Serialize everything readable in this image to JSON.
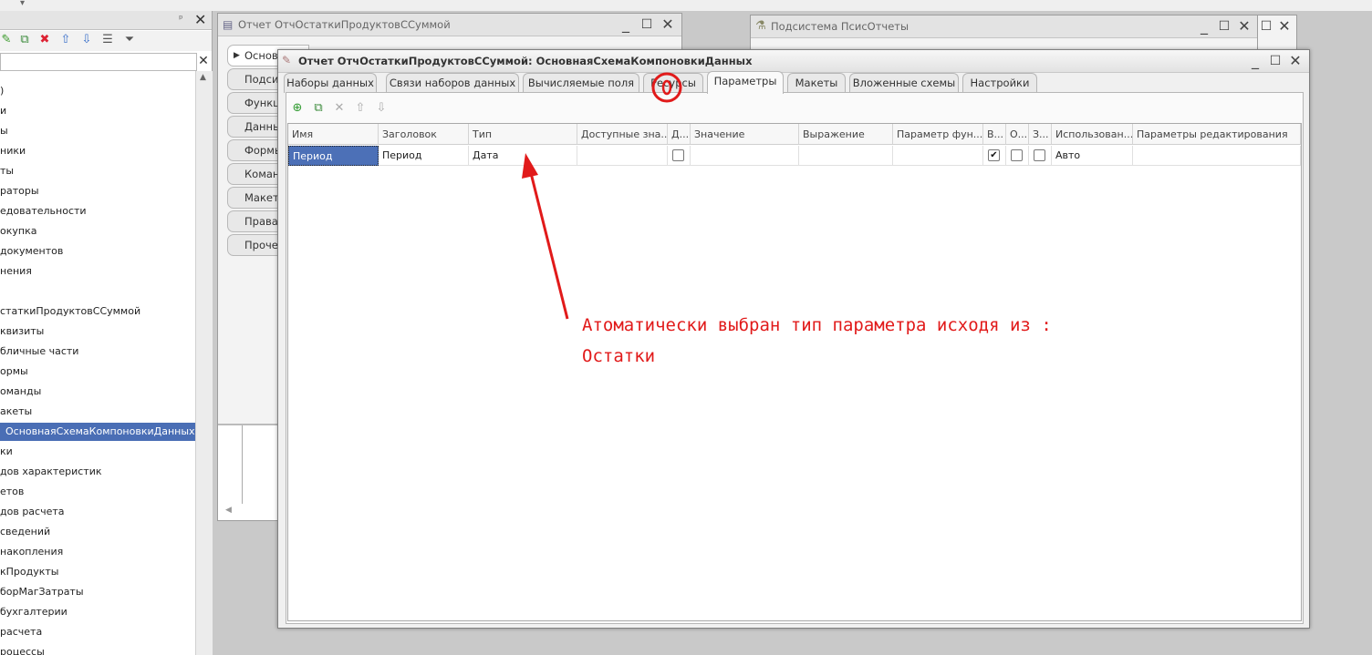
{
  "left_panel": {
    "tree_items": [
      {
        "label": ")"
      },
      {
        "label": "и"
      },
      {
        "label": "ы"
      },
      {
        "label": "ники"
      },
      {
        "label": "ты"
      },
      {
        "label": "раторы"
      },
      {
        "label": "едовательности"
      },
      {
        "label": "окупка"
      },
      {
        "label": " документов"
      },
      {
        "label": "нения"
      },
      {
        "label": ""
      },
      {
        "label": "статкиПродуктовССуммой"
      },
      {
        "label": "квизиты"
      },
      {
        "label": "бличные части"
      },
      {
        "label": "ормы"
      },
      {
        "label": "оманды"
      },
      {
        "label": "акеты"
      },
      {
        "label": "ОсновнаяСхемаКомпоновкиДанных",
        "selected": true
      },
      {
        "label": "ки"
      },
      {
        "label": "дов характеристик"
      },
      {
        "label": "етов"
      },
      {
        "label": "дов расчета"
      },
      {
        "label": " сведений"
      },
      {
        "label": " накопления"
      },
      {
        "label": "кПродукты"
      },
      {
        "label": "борМагЗатраты"
      },
      {
        "label": " бухгалтерии"
      },
      {
        "label": " расчета"
      },
      {
        "label": "роцессы"
      }
    ]
  },
  "report_window": {
    "title": "Отчет ОтчОстаткиПродуктовССуммой",
    "side_tabs": [
      "Основ",
      "Подсис",
      "Функц",
      "Данны",
      "Формы",
      "Коман",
      "Макеты",
      "Права",
      "Проче"
    ]
  },
  "subsystem_window": {
    "title": "Подсистема ПсисОтчеты"
  },
  "dialog": {
    "title": "Отчет ОтчОстаткиПродуктовССуммой: ОсновнаяСхемаКомпоновкиДанных",
    "tabs": [
      {
        "label": "Наборы данных"
      },
      {
        "label": "Связи наборов данных"
      },
      {
        "label": "Вычисляемые поля"
      },
      {
        "label": "Ресурсы"
      },
      {
        "label": "Параметры",
        "active": true
      },
      {
        "label": "Макеты"
      },
      {
        "label": "Вложенные схемы"
      },
      {
        "label": "Настройки"
      }
    ],
    "grid": {
      "columns": [
        "Имя",
        "Заголовок",
        "Тип",
        "Доступные зна...",
        "Д...",
        "Значение",
        "Выражение",
        "Параметр фун...",
        "В...",
        "О...",
        "З...",
        "Использован...",
        "Параметры редактирования"
      ],
      "rows": [
        {
          "name": "Период",
          "title": "Период",
          "type": "Дата",
          "available": "",
          "d": false,
          "value": "",
          "expression": "",
          "func_param": "",
          "v": true,
          "o": false,
          "z": false,
          "usage": "Авто",
          "edit_params": ""
        }
      ]
    }
  },
  "annotation": {
    "line1": "Атоматически выбран тип параметра исходя из :",
    "line2": "Остатки",
    "color": "#e11a1a"
  }
}
